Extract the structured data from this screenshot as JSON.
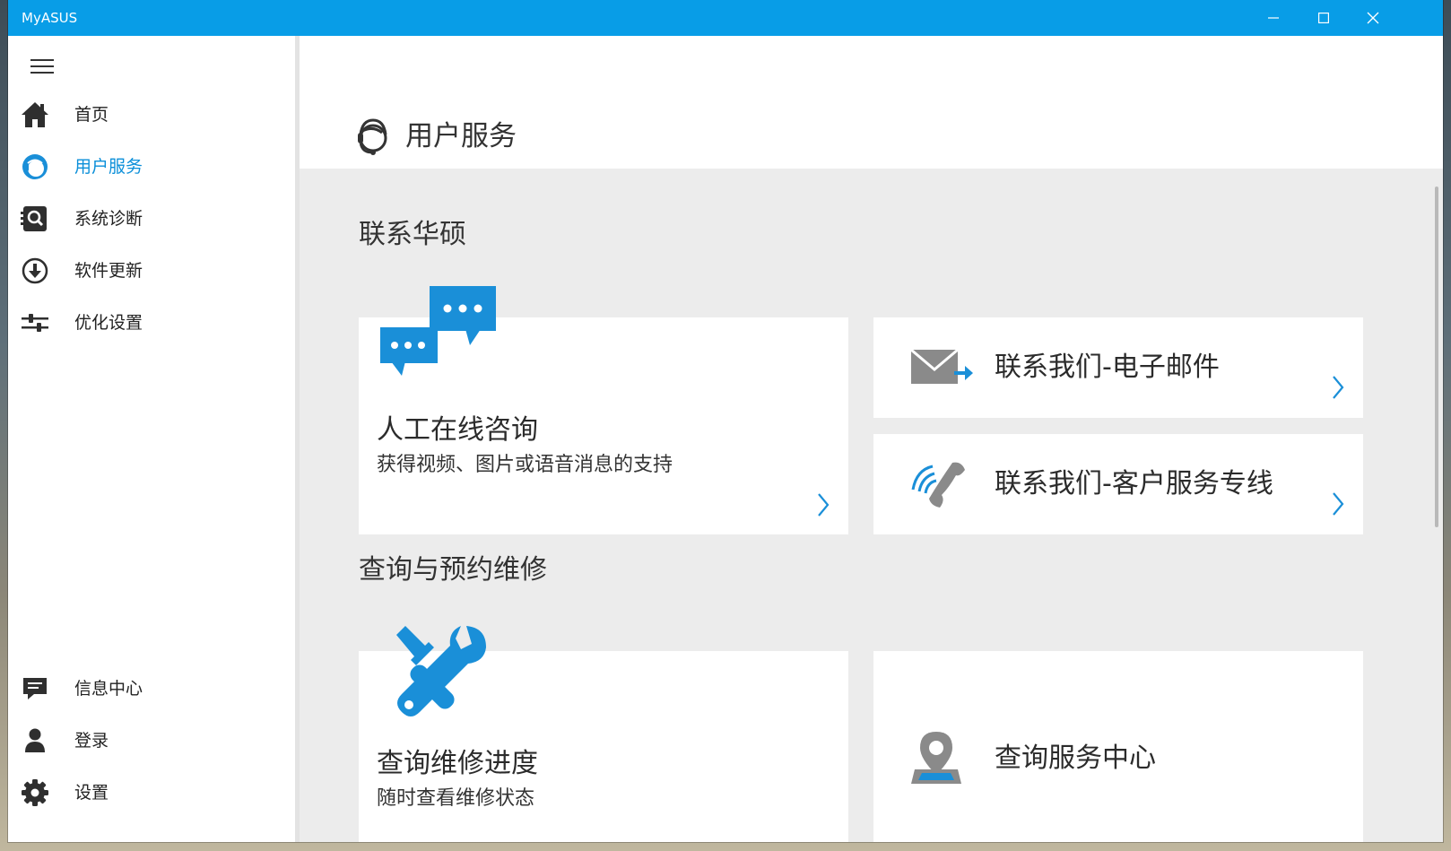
{
  "window": {
    "title": "MyASUS",
    "controls": [
      "minimize",
      "maximize",
      "close"
    ],
    "accent_color": "#089de7"
  },
  "sidebar": {
    "menu_icon": "hamburger-menu-icon",
    "items": [
      {
        "label": "首页",
        "icon": "home-icon",
        "active": false
      },
      {
        "label": "用户服务",
        "icon": "customer-service-headset-icon",
        "active": true
      },
      {
        "label": "系统诊断",
        "icon": "diagnosis-magnifier-icon",
        "active": false
      },
      {
        "label": "软件更新",
        "icon": "download-circle-icon",
        "active": false
      },
      {
        "label": "优化设置",
        "icon": "sliders-icon",
        "active": false
      }
    ],
    "bottom_items": [
      {
        "label": "信息中心",
        "icon": "message-icon"
      },
      {
        "label": "登录",
        "icon": "user-icon"
      },
      {
        "label": "设置",
        "icon": "gear-icon"
      }
    ],
    "active_color": "#0b8fd9"
  },
  "main": {
    "page_title": "用户服务",
    "page_icon": "headset-icon",
    "sections": [
      {
        "title": "联系华硕",
        "cards": [
          {
            "title": "人工在线咨询",
            "subtitle": "获得视频、图片或语音消息的支持",
            "icon": "chat-bubbles-icon"
          },
          {
            "title": "联系我们-电子邮件",
            "icon": "email-arrow-icon"
          },
          {
            "title": "联系我们-客户服务专线",
            "icon": "phone-signal-icon"
          }
        ]
      },
      {
        "title": "查询与预约维修",
        "cards": [
          {
            "title": "查询维修进度",
            "subtitle": "随时查看维修状态",
            "icon": "repair-tools-icon"
          },
          {
            "title": "查询服务中心",
            "icon": "map-pin-icon"
          }
        ]
      }
    ],
    "icon_color": "#1a8fd8"
  }
}
